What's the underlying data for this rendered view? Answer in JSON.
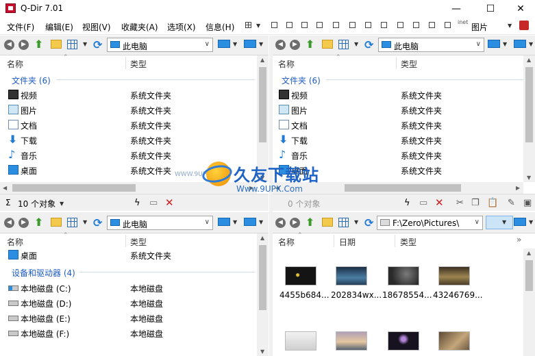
{
  "window": {
    "title": "Q-Dir 7.01",
    "minimize": "—",
    "maximize": "☐",
    "close": "✕"
  },
  "menu": {
    "items": [
      "文件(F)",
      "编辑(E)",
      "视图(V)",
      "收藏夹(A)",
      "选项(X)",
      "信息(H)"
    ],
    "extra_label": "图片",
    "inet_label": "inet"
  },
  "columns": {
    "name": "名称",
    "type": "类型",
    "date": "日期"
  },
  "pane_tl": {
    "address": "此电脑",
    "group": "文件夹 (6)",
    "rows": [
      {
        "name": "视频",
        "type": "系统文件夹",
        "icon": "video-icon"
      },
      {
        "name": "图片",
        "type": "系统文件夹",
        "icon": "pictures-icon"
      },
      {
        "name": "文档",
        "type": "系统文件夹",
        "icon": "documents-icon"
      },
      {
        "name": "下载",
        "type": "系统文件夹",
        "icon": "download-icon"
      },
      {
        "name": "音乐",
        "type": "系统文件夹",
        "icon": "music-icon"
      },
      {
        "name": "桌面",
        "type": "系统文件夹",
        "icon": "desktop-icon"
      }
    ],
    "status": "10 个对象"
  },
  "pane_tr": {
    "address": "此电脑",
    "group": "文件夹 (6)",
    "rows": [
      {
        "name": "视频",
        "type": "系统文件夹"
      },
      {
        "name": "图片",
        "type": "系统文件夹"
      },
      {
        "name": "文档",
        "type": "系统文件夹"
      },
      {
        "name": "下载",
        "type": "系统文件夹"
      },
      {
        "name": "音乐",
        "type": "系统文件夹"
      },
      {
        "name": "桌面",
        "type": "系统文件夹"
      }
    ],
    "status": "0 个对象"
  },
  "pane_bl": {
    "address": "此电脑",
    "top_row": {
      "name": "桌面",
      "type": "系统文件夹"
    },
    "group": "设备和驱动器 (4)",
    "drives": [
      {
        "name": "本地磁盘 (C:)",
        "type": "本地磁盘"
      },
      {
        "name": "本地磁盘 (D:)",
        "type": "本地磁盘"
      },
      {
        "name": "本地磁盘 (E:)",
        "type": "本地磁盘"
      },
      {
        "name": "本地磁盘 (F:)",
        "type": "本地磁盘"
      }
    ]
  },
  "pane_br": {
    "address": "F:\\Zero\\Pictures\\",
    "thumbnails": [
      "4455b684...",
      "202834wx...",
      "18678554...",
      "43246769..."
    ],
    "thumb_colors": [
      "#1a1a1a",
      "#2e5573",
      "#3a3a3a",
      "#7a6a45",
      "#d9d9d9",
      "#9a8fa6",
      "#1c1628",
      "#8a7a60"
    ]
  },
  "watermark": {
    "title": "久友下载站",
    "url": "Www.9UPK.Com",
    "small": "WWW.9UPK.COM"
  }
}
